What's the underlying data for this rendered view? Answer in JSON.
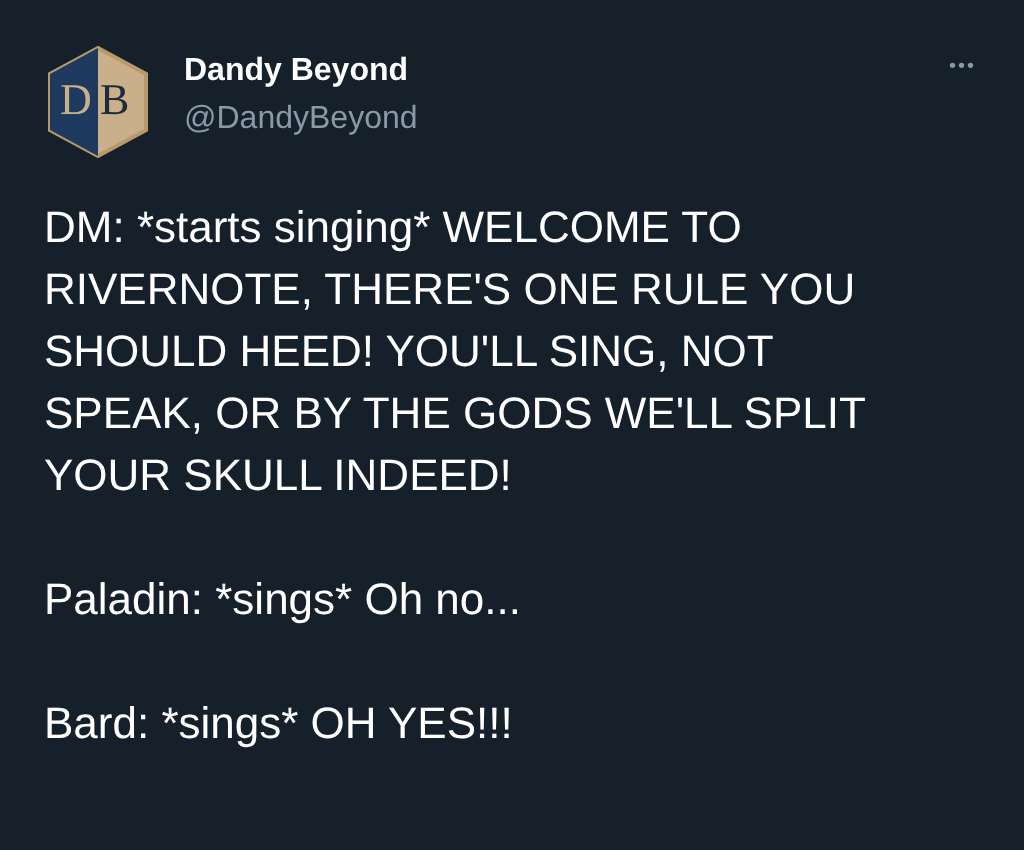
{
  "author": {
    "logo_letters": [
      "D",
      "B"
    ],
    "name": "Dandy Beyond",
    "handle": "@DandyBeyond"
  },
  "menu": "•••",
  "paragraphs": [
    "DM: *starts singing* WELCOME TO RIVERNOTE, THERE'S ONE RULE YOU SHOULD HEED! YOU'LL SING, NOT SPEAK, OR BY THE GODS WE'LL SPLIT YOUR SKULL INDEED!",
    "Paladin: *sings* Oh no...",
    "Bard: *sings* OH YES!!!"
  ]
}
